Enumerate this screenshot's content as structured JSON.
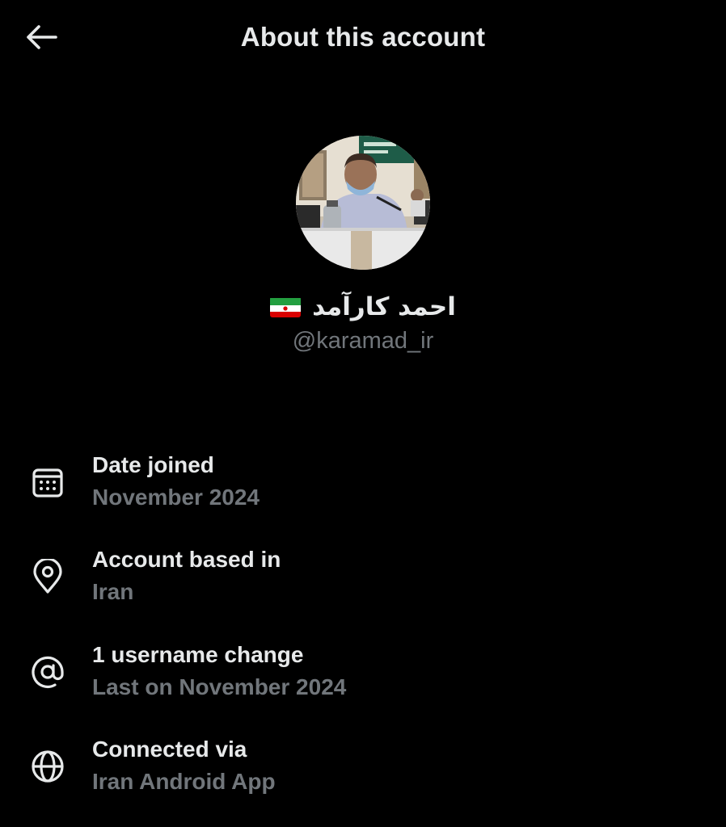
{
  "header": {
    "title": "About this account",
    "back_icon": "arrow-left-icon"
  },
  "profile": {
    "display_name": "احمد کارآمد",
    "flag_icon": "iran-flag-icon",
    "handle": "@karamad_ir"
  },
  "details": [
    {
      "icon": "calendar-icon",
      "title": "Date joined",
      "value": "November 2024"
    },
    {
      "icon": "location-pin-icon",
      "title": "Account based in",
      "value": "Iran"
    },
    {
      "icon": "at-sign-icon",
      "title": "1 username change",
      "value": "Last on November 2024"
    },
    {
      "icon": "globe-icon",
      "title": "Connected via",
      "value": "Iran Android App"
    }
  ],
  "colors": {
    "background": "#000000",
    "primary_text": "#e7e9ea",
    "secondary_text": "#71767b"
  }
}
